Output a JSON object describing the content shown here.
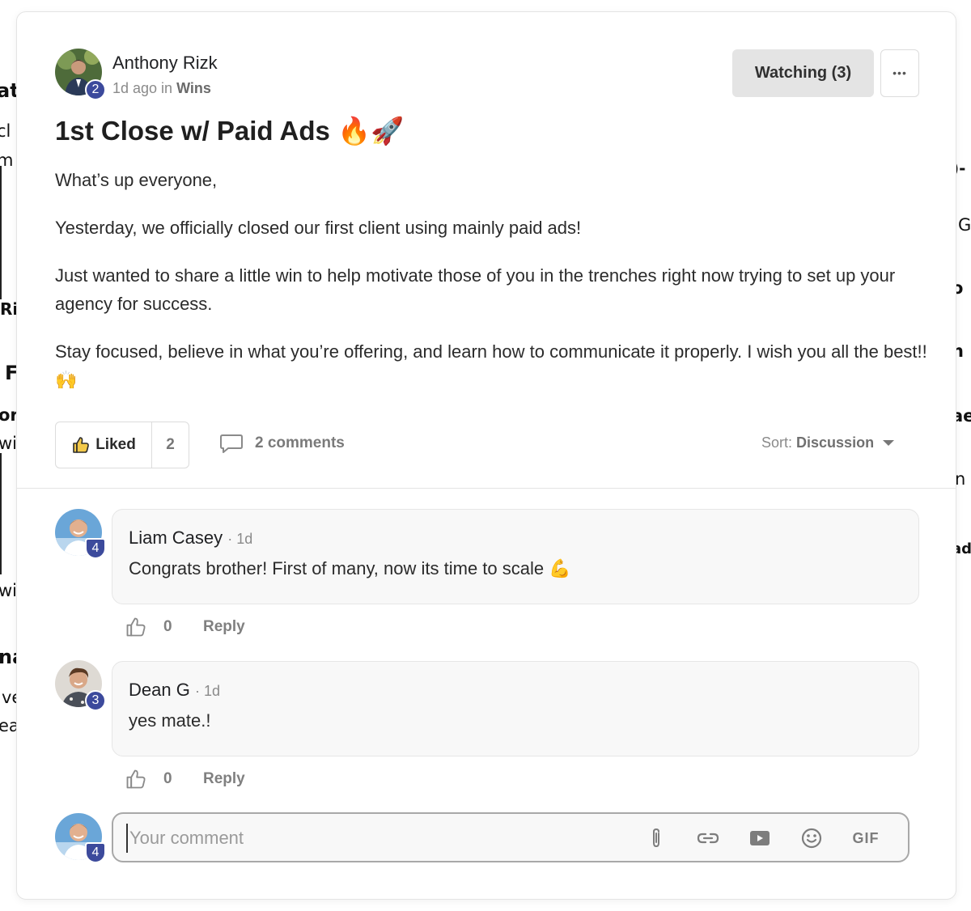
{
  "background_fragments": [
    "at",
    "cl",
    "m",
    "Ri",
    "F",
    "or",
    "wi",
    "wi",
    "na",
    "ve",
    "ea",
    ")-",
    "G",
    "o",
    "n",
    "ae",
    "n",
    "ad"
  ],
  "post": {
    "author": "Anthony Rizk",
    "author_level": "2",
    "time_ago": "1d ago in",
    "category": "Wins",
    "watch_label": "Watching (3)",
    "more_label": "•••",
    "title": "1st Close w/ Paid Ads 🔥🚀",
    "paragraphs": [
      "What’s up everyone,",
      "Yesterday, we officially closed our first client using mainly paid ads!",
      "Just wanted to share a little win to help motivate those of you in the trenches right now trying to set up your agency for success.",
      "Stay focused, believe in what you’re offering, and learn how to communicate it properly. I wish you all the best!! 🙌"
    ],
    "like_label": "Liked",
    "like_count": "2",
    "comments_label": "2 comments",
    "sort_prefix": "Sort:",
    "sort_value": "Discussion"
  },
  "comments": [
    {
      "author": "Liam Casey",
      "time": "· 1d",
      "level": "4",
      "text": "Congrats brother! First of many, now its time to scale 💪",
      "likes": "0",
      "reply_label": "Reply"
    },
    {
      "author": "Dean G",
      "time": "· 1d",
      "level": "3",
      "text": "yes mate.!",
      "likes": "0",
      "reply_label": "Reply"
    }
  ],
  "composer": {
    "level": "4",
    "placeholder": "Your comment",
    "gif_label": "GIF"
  },
  "colors": {
    "level_badge": "#3c4a9c",
    "watch_bg": "#e4e4e4",
    "bubble_bg": "#f8f8f8"
  }
}
